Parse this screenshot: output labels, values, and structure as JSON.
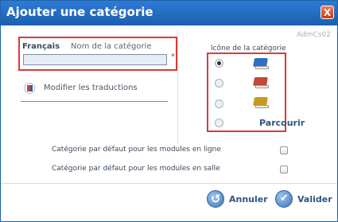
{
  "dialog": {
    "title": "Ajouter une catégorie",
    "close_glyph": "X",
    "screen_code": "AdmCs02"
  },
  "name_section": {
    "language_label": "Français",
    "name_label": "Nom de la catégorie",
    "name_value": "",
    "required_marker": "*",
    "translations_link": "Modifier les traductions"
  },
  "icon_section": {
    "label": "Icône de la catégorie",
    "selected_option": 1,
    "options": [
      {
        "icon": "blue-book-icon",
        "color": "#2f6fc0"
      },
      {
        "icon": "red-book-icon",
        "color": "#c2473d"
      },
      {
        "icon": "gold-book-icon",
        "color": "#c79a24"
      }
    ],
    "browse_label": "Parcourir"
  },
  "options": {
    "online_default_label": "Catégorie par défaut pour les modules en ligne",
    "online_default_checked": false,
    "classroom_default_label": "Catégorie par défaut pour les modules en salle",
    "classroom_default_checked": false
  },
  "footer": {
    "cancel_label": "Annuler",
    "ok_label": "Valider"
  },
  "colors": {
    "titlebar": "#1b5fb0",
    "highlight_border": "#d93b39",
    "button_text": "#2e557f"
  }
}
